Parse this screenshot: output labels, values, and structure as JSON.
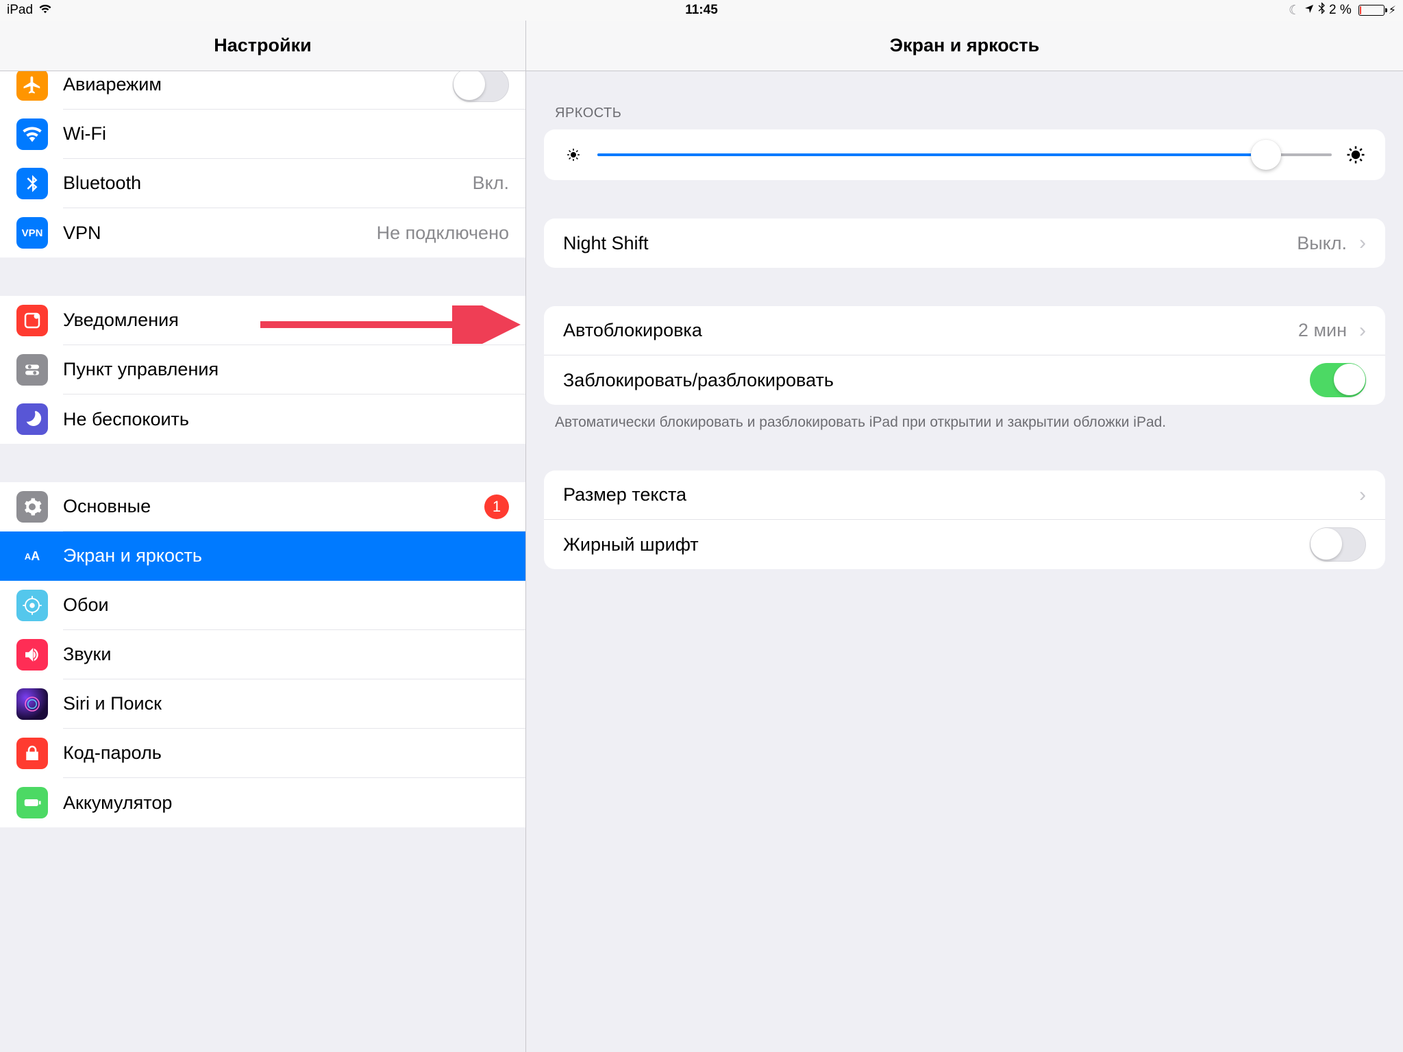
{
  "statusbar": {
    "device": "iPad",
    "time": "11:45",
    "battery_percent": "2 %"
  },
  "sidebar": {
    "title": "Настройки",
    "groups": [
      {
        "rows": [
          {
            "id": "airplane",
            "label": "Авиарежим",
            "toggle": false
          },
          {
            "id": "wifi",
            "label": "Wi-Fi",
            "value": ""
          },
          {
            "id": "bluetooth",
            "label": "Bluetooth",
            "value": "Вкл."
          },
          {
            "id": "vpn",
            "label": "VPN",
            "value": "Не подключено",
            "icon_text": "VPN"
          }
        ]
      },
      {
        "rows": [
          {
            "id": "notifications",
            "label": "Уведомления"
          },
          {
            "id": "controlcenter",
            "label": "Пункт управления"
          },
          {
            "id": "dnd",
            "label": "Не беспокоить"
          }
        ]
      },
      {
        "rows": [
          {
            "id": "general",
            "label": "Основные",
            "badge": "1"
          },
          {
            "id": "display",
            "label": "Экран и яркость",
            "selected": true,
            "icon_text": "AA"
          },
          {
            "id": "wallpaper",
            "label": "Обои"
          },
          {
            "id": "sounds",
            "label": "Звуки"
          },
          {
            "id": "siri",
            "label": "Siri и Поиск"
          },
          {
            "id": "passcode",
            "label": "Код-пароль"
          },
          {
            "id": "battery",
            "label": "Аккумулятор"
          }
        ]
      }
    ]
  },
  "detail": {
    "title": "Экран и яркость",
    "brightness_label": "ЯРКОСТЬ",
    "brightness_percent": 91,
    "night_shift": {
      "label": "Night Shift",
      "value": "Выкл."
    },
    "autolock": {
      "label": "Автоблокировка",
      "value": "2 мин"
    },
    "lock_unlock": {
      "label": "Заблокировать/разблокировать",
      "on": true
    },
    "lock_footer": "Автоматически блокировать и разблокировать iPad при открытии и закрытии обложки iPad.",
    "text_size": {
      "label": "Размер текста"
    },
    "bold_text": {
      "label": "Жирный шрифт",
      "on": false
    }
  }
}
